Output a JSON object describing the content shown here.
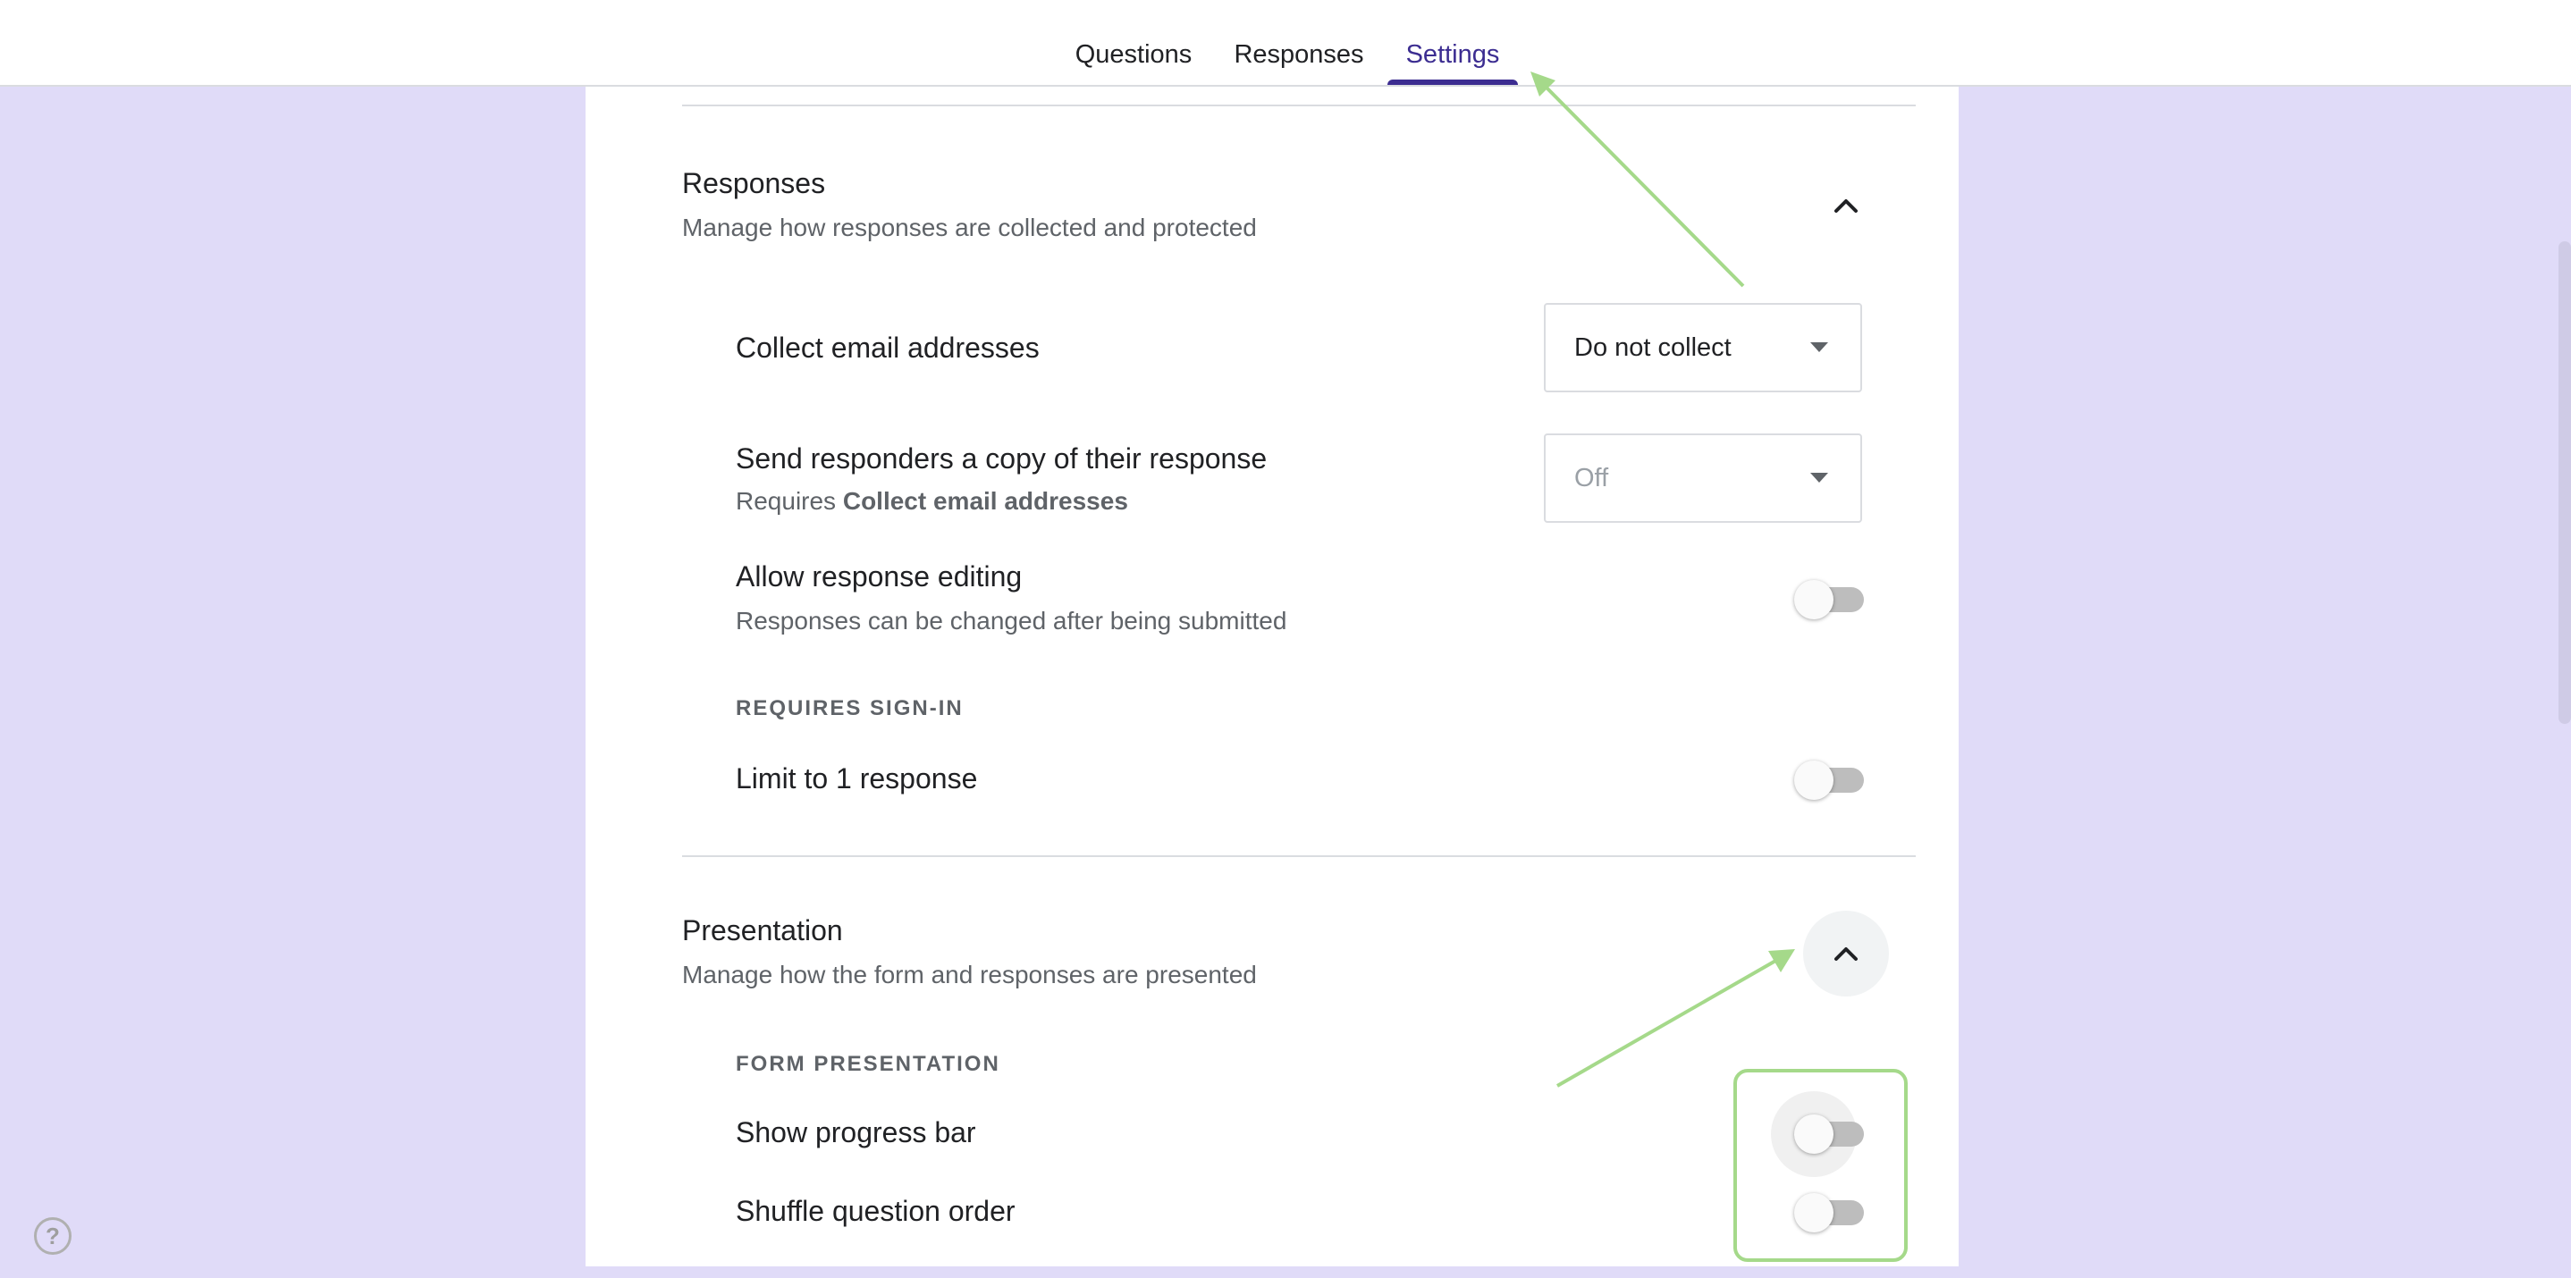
{
  "header": {
    "tabs": [
      {
        "label": "Questions",
        "active": false
      },
      {
        "label": "Responses",
        "active": false
      },
      {
        "label": "Settings",
        "active": true
      }
    ]
  },
  "colors": {
    "accent": "#3c2d91",
    "page_background": "#e0dbf8",
    "annotation": "#a5d98a"
  },
  "responses_section": {
    "title": "Responses",
    "subtitle": "Manage how responses are collected and protected",
    "collapse_icon": "chevron-up-icon",
    "collect_email": {
      "label": "Collect email addresses",
      "selected": "Do not collect"
    },
    "send_copy": {
      "label": "Send responders a copy of their response",
      "requires_prefix": "Requires",
      "requires_bold": "Collect email addresses",
      "selected": "Off",
      "disabled": true
    },
    "allow_editing": {
      "label": "Allow response editing",
      "sublabel": "Responses can be changed after being submitted",
      "on": false
    },
    "requires_signin_heading": "REQUIRES SIGN-IN",
    "limit_one": {
      "label": "Limit to 1 response",
      "on": false
    }
  },
  "presentation_section": {
    "title": "Presentation",
    "subtitle": "Manage how the form and responses are presented",
    "collapse_icon": "chevron-up-icon",
    "form_presentation_heading": "FORM PRESENTATION",
    "show_progress_bar": {
      "label": "Show progress bar",
      "on": false
    },
    "shuffle_order": {
      "label": "Shuffle question order",
      "on": false
    }
  },
  "help_icon": {
    "icon": "help-circle-icon",
    "glyph": "?"
  }
}
